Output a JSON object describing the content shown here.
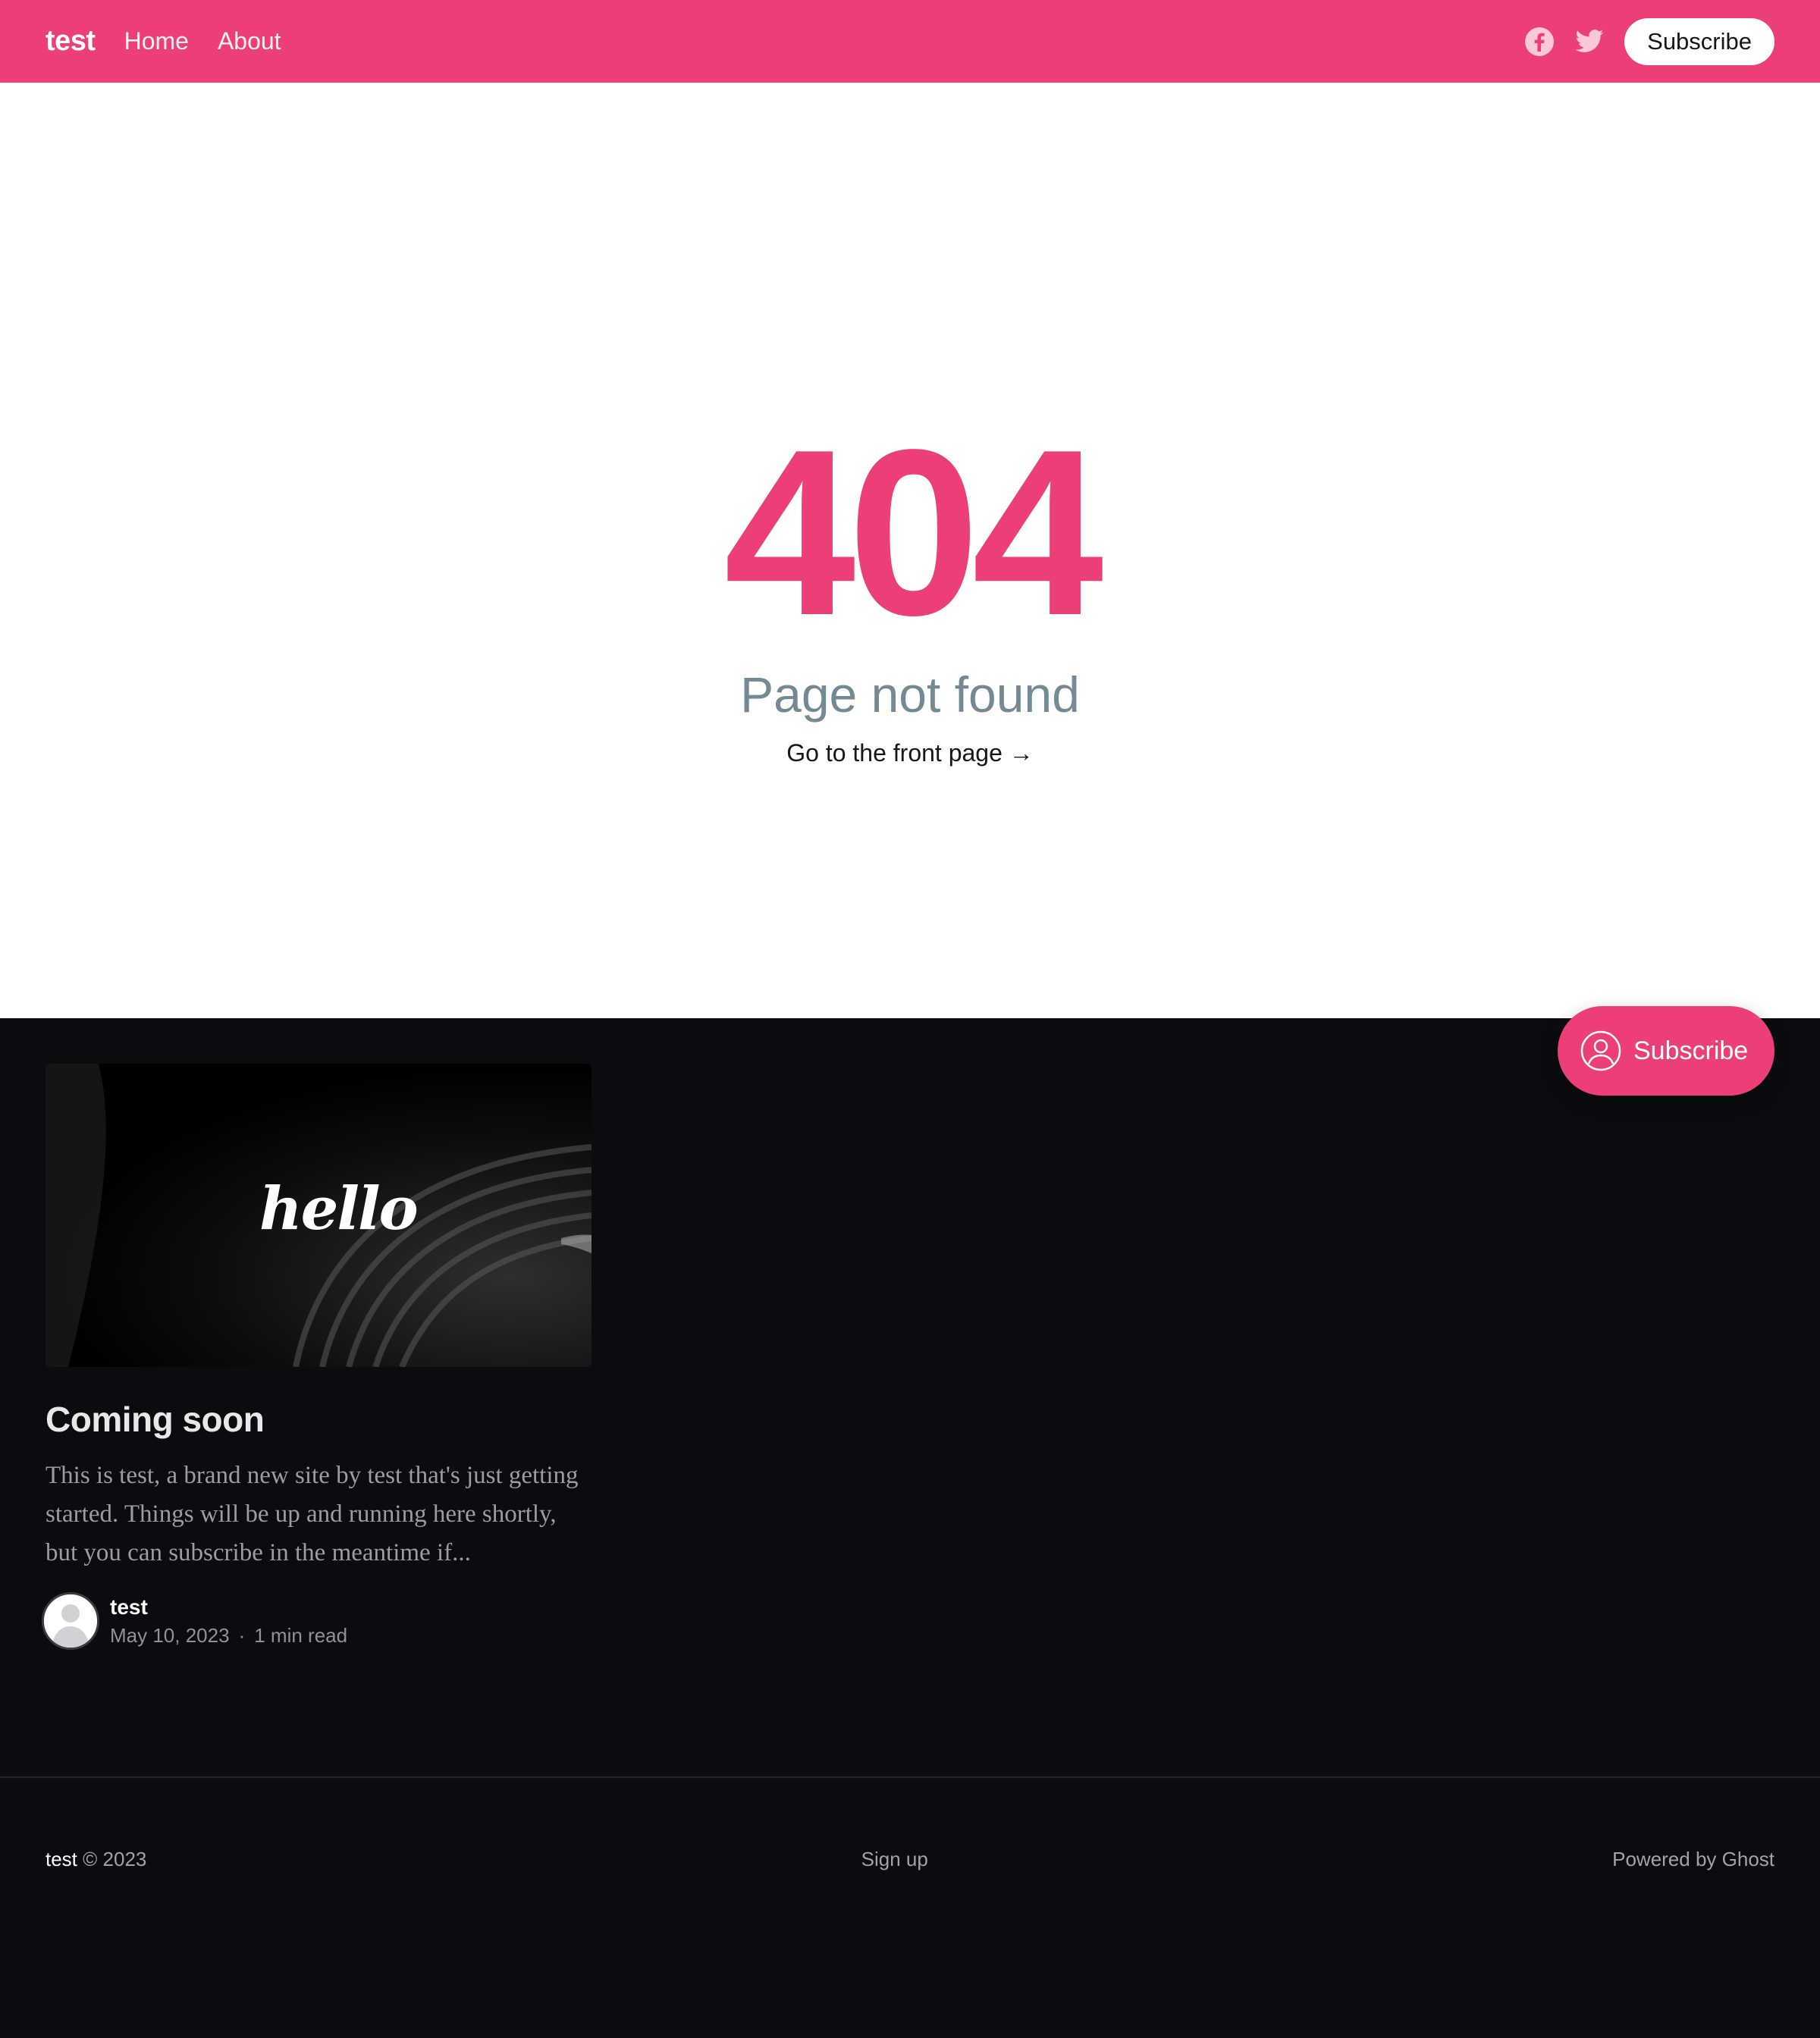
{
  "header": {
    "logo": "test",
    "nav": [
      "Home",
      "About"
    ],
    "subscribe_label": "Subscribe",
    "accent_color": "#ec3f78",
    "social_icons": [
      "facebook-icon",
      "twitter-icon"
    ]
  },
  "error": {
    "code": "404",
    "description": "Page not found",
    "link_text": "Go to the front page →"
  },
  "post": {
    "image_text": "hello",
    "title": "Coming soon",
    "excerpt": "This is test, a brand new site by test that's just getting started. Things will be up and running here shortly, but you can subscribe in the meantime if...",
    "author": "test",
    "date": "May 10, 2023",
    "reading_time": "1 min read"
  },
  "floating_subscribe": {
    "label": "Subscribe"
  },
  "footer": {
    "brand": "test",
    "copyright": "© 2023",
    "signup": "Sign up",
    "powered": "Powered by Ghost"
  }
}
